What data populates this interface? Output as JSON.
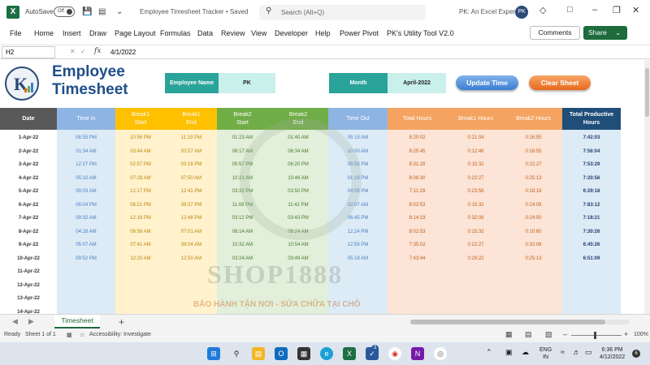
{
  "titlebar": {
    "autosave_label": "AutoSave",
    "autosave_state": "Off",
    "doc_title": "Employee Timesheet Tracker • Saved",
    "search_placeholder": "Search (Alt+Q)",
    "account_name": "PK: An Excel Expert",
    "avatar_initials": "PK"
  },
  "menu": {
    "items": [
      "File",
      "Home",
      "Insert",
      "Draw",
      "Page Layout",
      "Formulas",
      "Data",
      "Review",
      "View",
      "Developer",
      "Help",
      "Power Pivot",
      "PK's Utility Tool V2.0"
    ],
    "comments": "Comments",
    "share": "Share"
  },
  "formula_bar": {
    "name_box": "H2",
    "fx": "fx",
    "content": "4/1/2022"
  },
  "sheet": {
    "title_line1": "Employee",
    "title_line2": "Timesheet",
    "employee_name_label": "Employee Name",
    "employee_name_value": "PK",
    "month_label": "Month",
    "month_value": "April-2022",
    "update_button": "Update Time",
    "clear_button": "Clear Sheet",
    "watermark": "SHOP1888",
    "watermark_sub": "BẢO HÀNH TẬN NƠI - SỬA CHỮA TẠI CHỖ",
    "columns": [
      {
        "header": "Date",
        "bg": "#ffffff",
        "head_bg": "#595959",
        "head_color": "#ffffff",
        "text_color": "#333333"
      },
      {
        "header": "Time In",
        "bg": "#ddebf7",
        "head_bg": "#8eb4e3",
        "head_color": "#ffffff",
        "text_color": "#4a7fc0"
      },
      {
        "header": "Break1\nStart",
        "bg": "#fff2cc",
        "head_bg": "#ffc000",
        "head_color": "#ffffff",
        "text_color": "#b8860b"
      },
      {
        "header": "Break1\nEnd",
        "bg": "#fff2cc",
        "head_bg": "#ffc000",
        "head_color": "#ffffff",
        "text_color": "#b8860b"
      },
      {
        "header": "Break2\nStart",
        "bg": "#e2efda",
        "head_bg": "#70ad47",
        "head_color": "#ffffff",
        "text_color": "#4a7a2c"
      },
      {
        "header": "Break2\nEnd",
        "bg": "#e2efda",
        "head_bg": "#70ad47",
        "head_color": "#ffffff",
        "text_color": "#4a7a2c"
      },
      {
        "header": "Time Out",
        "bg": "#ddebf7",
        "head_bg": "#8eb4e3",
        "head_color": "#ffffff",
        "text_color": "#4a7fc0"
      },
      {
        "header": "Total Hours",
        "bg": "#fce4d6",
        "head_bg": "#f4a460",
        "head_color": "#ffffff",
        "text_color": "#c0601a"
      },
      {
        "header": "Break1 Hours",
        "bg": "#fce4d6",
        "head_bg": "#f4a460",
        "head_color": "#ffffff",
        "text_color": "#c0601a"
      },
      {
        "header": "Break2 Hours",
        "bg": "#fce4d6",
        "head_bg": "#f4a460",
        "head_color": "#ffffff",
        "text_color": "#c0601a"
      },
      {
        "header": "Total Productive\nHours",
        "bg": "#ddebf7",
        "head_bg": "#1f4e79",
        "head_color": "#ffffff",
        "text_color": "#1f3f66"
      }
    ],
    "rows": [
      [
        "1-Apr-22",
        "08:55 PM",
        "10:58 PM",
        "11:19 PM",
        "01:23 AM",
        "01:40 AM",
        "05:15 AM",
        "8:20:02",
        "0:21:04",
        "0:16:55",
        "7:42:03"
      ],
      [
        "2-Apr-22",
        "01:34 AM",
        "03:44 AM",
        "03:57 AM",
        "06:17 AM",
        "06:34 AM",
        "10:00 AM",
        "8:25:45",
        "0:12:46",
        "0:16:55",
        "7:56:04"
      ],
      [
        "3-Apr-22",
        "12:27 PM",
        "02:57 PM",
        "03:18 PM",
        "05:57 PM",
        "06:20 PM",
        "08:58 PM",
        "8:31:28",
        "0:15:32",
        "0:22:27",
        "7:53:29"
      ],
      [
        "4-Apr-22",
        "05:10 AM",
        "07:28 AM",
        "07:50 AM",
        "10:21 AM",
        "10:46 AM",
        "01:19 PM",
        "8:08:30",
        "0:22:27",
        "0:25:13",
        "7:20:56"
      ],
      [
        "5-Apr-22",
        "09:03 AM",
        "12:17 PM",
        "12:41 PM",
        "03:32 PM",
        "03:50 PM",
        "04:59 PM",
        "7:11:28",
        "0:23:58",
        "0:18:18",
        "6:29:18"
      ],
      [
        "6-Apr-22",
        "06:04 PM",
        "08:21 PM",
        "08:37 PM",
        "11:08 PM",
        "11:42 PM",
        "02:07 AM",
        "8:02:53",
        "0:15:32",
        "0:24:08",
        "7:83:12"
      ],
      [
        "7-Apr-22",
        "09:32 AM",
        "12:16 PM",
        "12:48 PM",
        "03:12 PM",
        "03:43 PM",
        "06:45 PM",
        "8:14:19",
        "0:32:08",
        "0:24:50",
        "7:18:21"
      ],
      [
        "8-Apr-22",
        "04:28 AM",
        "06:58 AM",
        "07:01 AM",
        "08:14 AM",
        "09:24 AM",
        "12:24 PM",
        "8:02:53",
        "0:15:32",
        "0:10:60",
        "7:30:26"
      ],
      [
        "9-Apr-22",
        "05:07 AM",
        "07:41 AM",
        "08:04 AM",
        "10:32 AM",
        "10:54 AM",
        "12:58 PM",
        "7:35:02",
        "0:22:27",
        "0:32:08",
        "6:45:26"
      ],
      [
        "10-Apr-22",
        "09:52 PM",
        "12:20 AM",
        "12:50 AM",
        "03:24 AM",
        "03:49 AM",
        "05:18 AM",
        "7:43:44",
        "0:29:22",
        "0:25:13",
        "6:51:09"
      ],
      [
        "11-Apr-22",
        "",
        "",
        "",
        "",
        "",
        "",
        "",
        "",
        "",
        ""
      ],
      [
        "12-Apr-22",
        "",
        "",
        "",
        "",
        "",
        "",
        "",
        "",
        "",
        ""
      ],
      [
        "13-Apr-22",
        "",
        "",
        "",
        "",
        "",
        "",
        "",
        "",
        "",
        ""
      ],
      [
        "14-Apr-22",
        "",
        "",
        "",
        "",
        "",
        "",
        "",
        "",
        "",
        ""
      ]
    ]
  },
  "tabs": {
    "sheet_tab": "Timesheet",
    "add": "+"
  },
  "status": {
    "ready": "Ready",
    "sheet_info": "Sheet 1 of 1",
    "accessibility": "Accessibility: Investigate",
    "zoom": "100%"
  },
  "taskbar": {
    "lang_line1": "ENG",
    "lang_line2": "IN",
    "time": "6:36 PM",
    "date": "4/12/2022",
    "notif_count": "6",
    "badge_count": "3"
  }
}
